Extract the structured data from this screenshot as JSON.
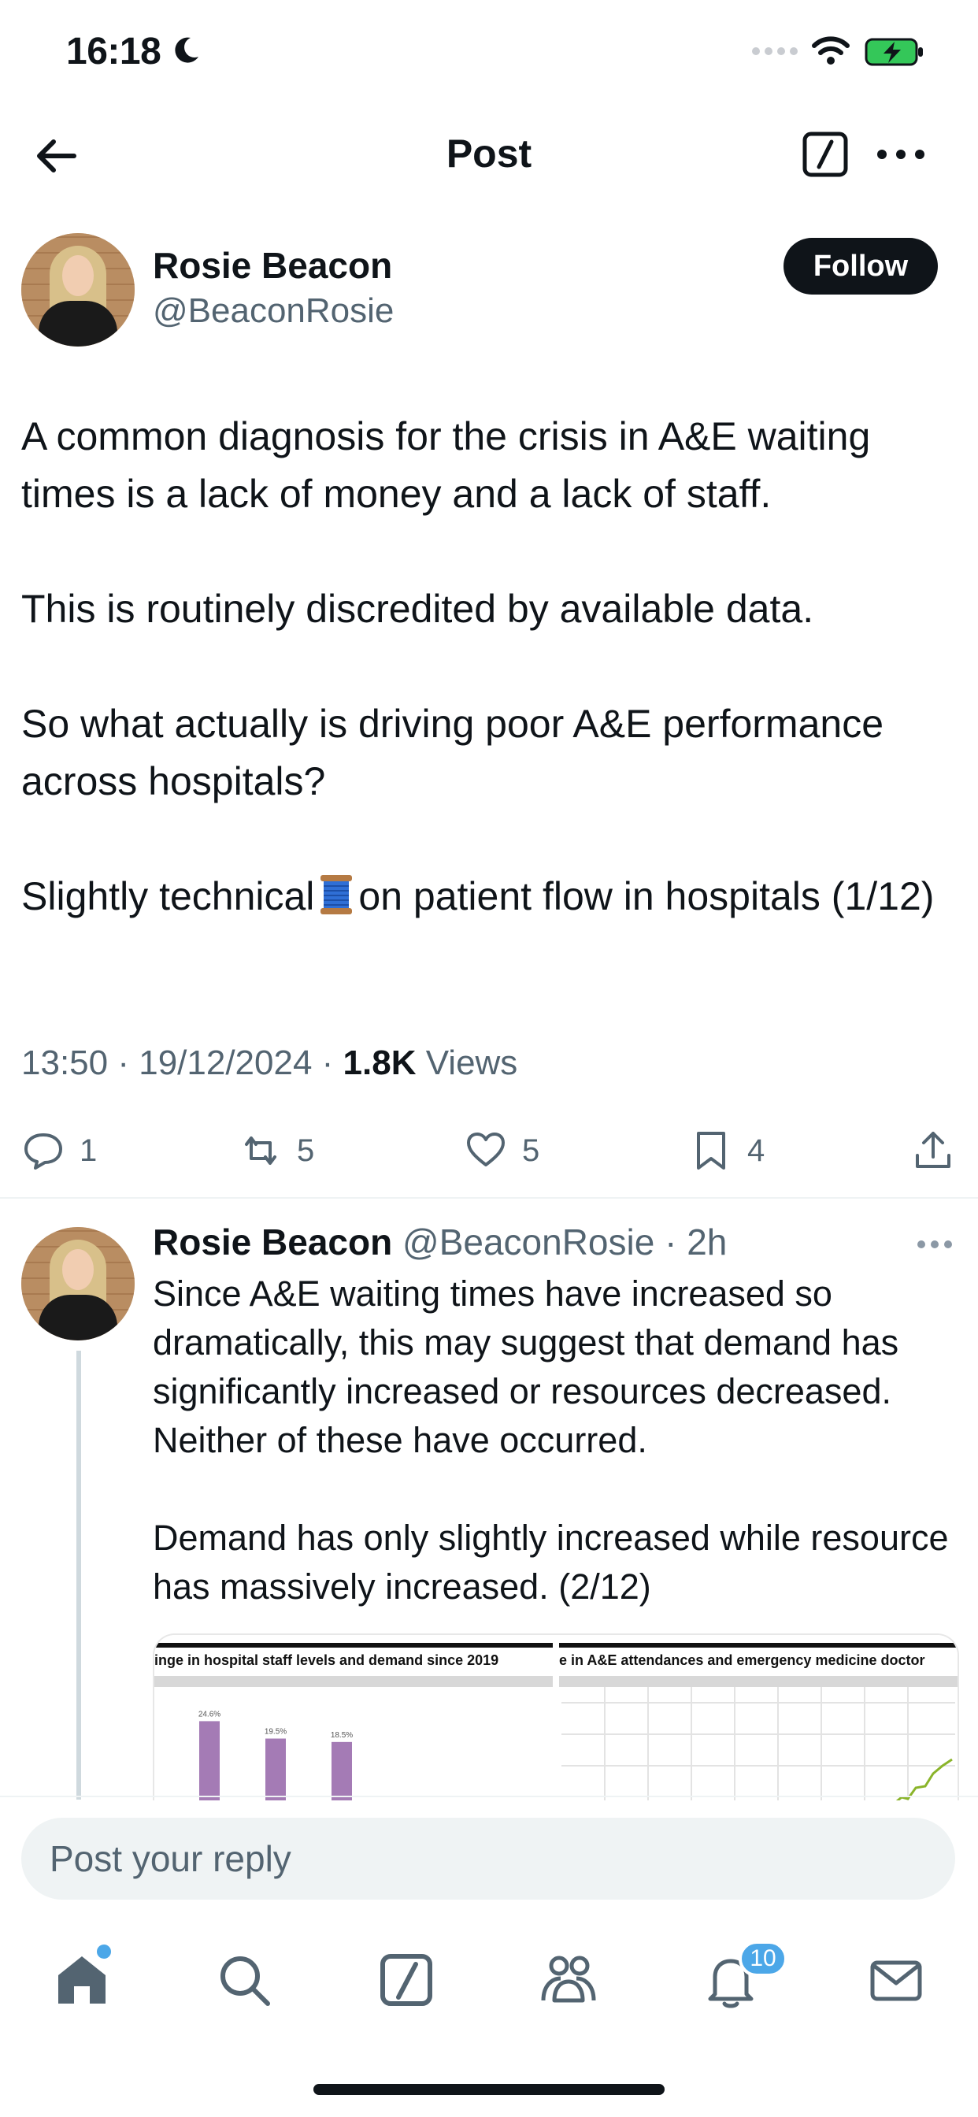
{
  "status_bar": {
    "time": "16:18"
  },
  "header": {
    "title": "Post"
  },
  "post": {
    "author_name": "Rosie Beacon",
    "author_handle": "@BeaconRosie",
    "follow_label": "Follow",
    "paragraphs": [
      "A common diagnosis for the crisis in A&E waiting times is a lack of money and a lack of staff.",
      "This is routinely discredited by available data.",
      "So what actually is driving poor A&E performance across hospitals?"
    ],
    "last_line_before": "Slightly technical",
    "last_line_after": "on patient flow in hospitals (1/12)",
    "time": "13:50",
    "date": "19/12/2024",
    "views_count": "1.8K",
    "views_label": "Views",
    "reply_count": "1",
    "repost_count": "5",
    "like_count": "5",
    "bookmark_count": "4"
  },
  "reply": {
    "author_name": "Rosie Beacon",
    "author_handle": "@BeaconRosie",
    "age": "2h",
    "paragraphs": [
      "Since A&E waiting times have increased so dramatically, this may suggest that demand has significantly increased or resources decreased. Neither of these have occurred.",
      "Demand has only slightly increased while resource has massively increased. (2/12)"
    ],
    "image1": {
      "caption": "inge in hospital staff levels and demand since 2019",
      "chart_data": {
        "type": "bar",
        "values": [
          24.6,
          19.5,
          18.5
        ],
        "value_labels": [
          "24.6%",
          "19.5%",
          "18.5%"
        ]
      }
    },
    "image2": {
      "caption": "e in A&E attendances and emergency medicine doctor"
    }
  },
  "composer": {
    "placeholder": "Post your reply"
  },
  "tab_bar": {
    "notifications_badge": "10"
  },
  "colors": {
    "accent": "#1d9bf0",
    "badge": "#4ca7e8",
    "muted": "#536471",
    "bar": "#a47bb5",
    "line": "#8ab42a"
  }
}
